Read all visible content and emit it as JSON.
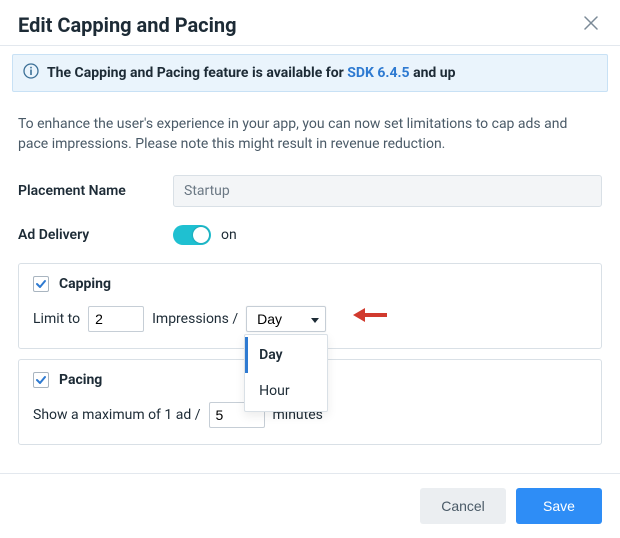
{
  "header": {
    "title": "Edit Capping and Pacing"
  },
  "banner": {
    "prefix": "The Capping and Pacing feature is available for ",
    "link": "SDK 6.4.5",
    "suffix": " and up"
  },
  "description": "To enhance the user's experience in your app, you can now set limitations to cap ads and pace impressions. Please note this might result in revenue reduction.",
  "fields": {
    "placement_label": "Placement Name",
    "placement_value": "Startup",
    "delivery_label": "Ad Delivery",
    "delivery_state": "on"
  },
  "capping": {
    "title": "Capping",
    "limit_to": "Limit to",
    "value": "2",
    "impressions": "Impressions /",
    "unit_selected": "Day",
    "unit_options": {
      "day": "Day",
      "hour": "Hour"
    }
  },
  "pacing": {
    "title": "Pacing",
    "prefix": "Show a maximum of 1 ad /",
    "value": "5",
    "suffix": "minutes"
  },
  "footer": {
    "cancel": "Cancel",
    "save": "Save"
  }
}
